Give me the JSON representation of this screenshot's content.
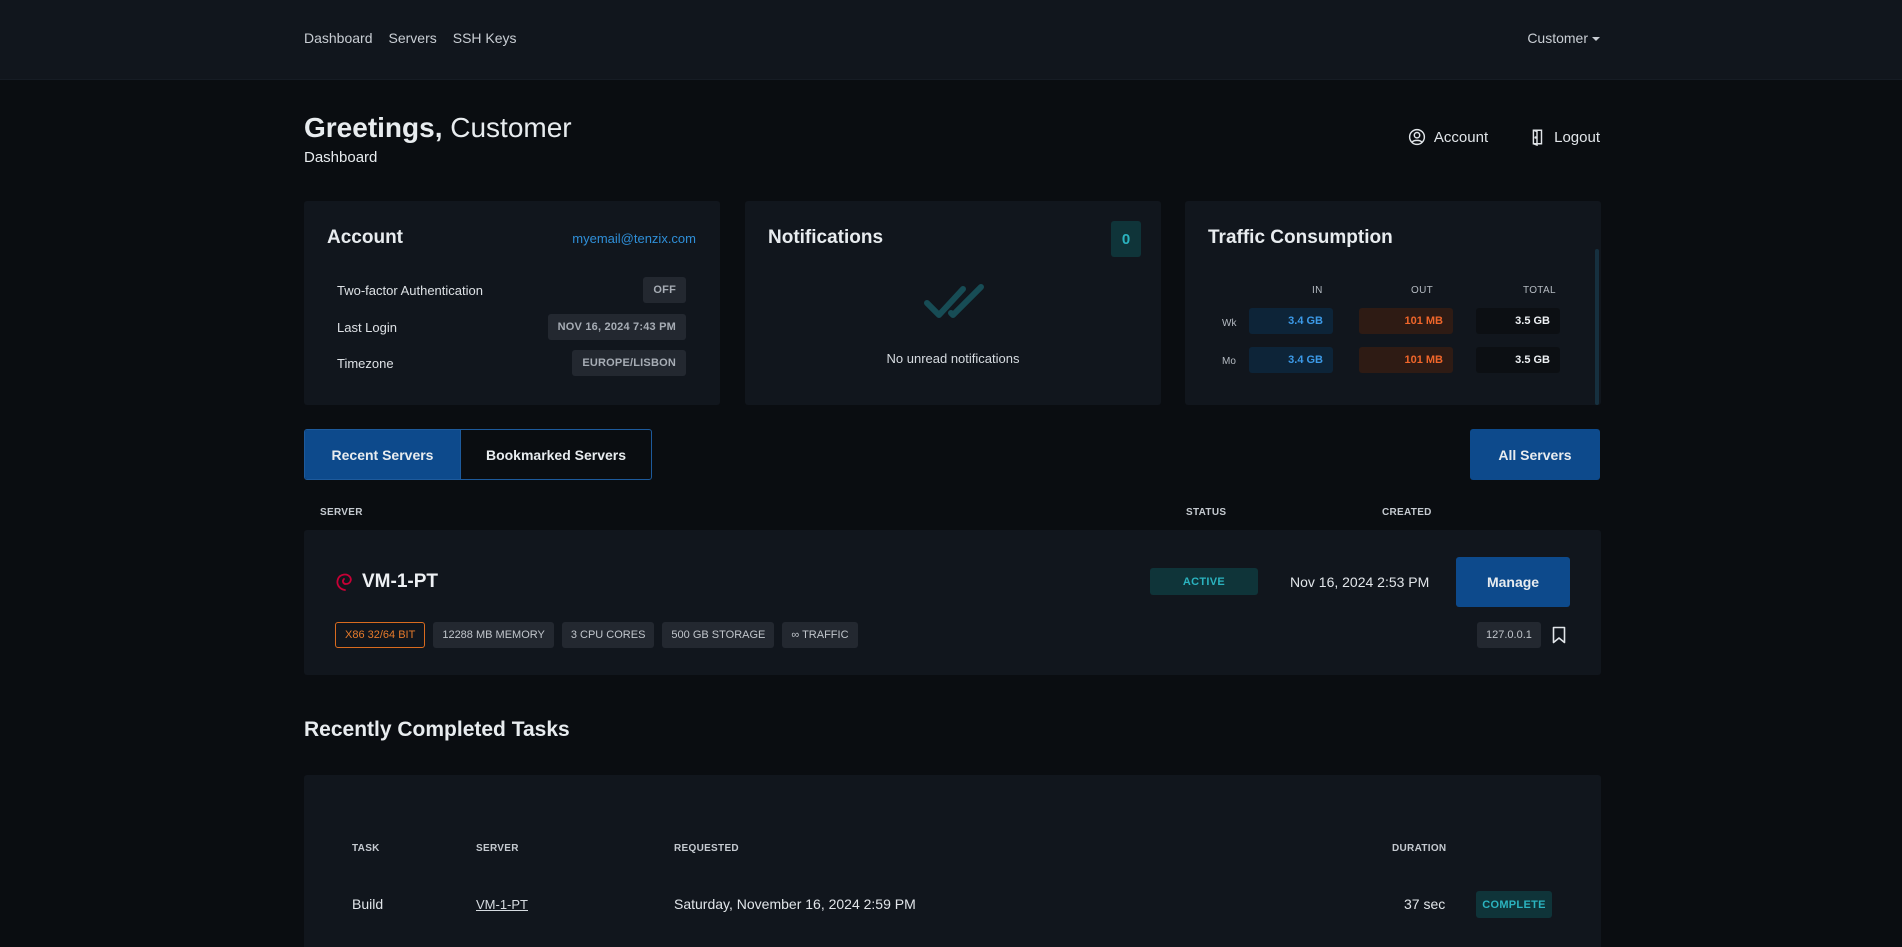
{
  "nav": {
    "items": [
      {
        "label": "Dashboard"
      },
      {
        "label": "Servers"
      },
      {
        "label": "SSH Keys"
      }
    ],
    "user_menu_label": "Customer"
  },
  "header": {
    "greeting": "Greetings,",
    "name": "Customer",
    "subtitle": "Dashboard",
    "account_label": "Account",
    "logout_label": "Logout"
  },
  "account_card": {
    "title": "Account",
    "email": "myemail@tenzix.com",
    "rows": [
      {
        "label": "Two-factor Authentication",
        "value": "OFF"
      },
      {
        "label": "Last Login",
        "value": "NOV 16, 2024 7:43 PM"
      },
      {
        "label": "Timezone",
        "value": "EUROPE/LISBON"
      }
    ]
  },
  "notifications_card": {
    "title": "Notifications",
    "count": "0",
    "empty_text": "No unread notifications"
  },
  "traffic_card": {
    "title": "Traffic Consumption",
    "columns": [
      "IN",
      "OUT",
      "TOTAL"
    ],
    "rows": [
      {
        "label": "Wk",
        "in": "3.4 GB",
        "out": "101 MB",
        "total": "3.5 GB"
      },
      {
        "label": "Mo",
        "in": "3.4 GB",
        "out": "101 MB",
        "total": "3.5 GB"
      }
    ]
  },
  "server_tabs": {
    "recent": "Recent Servers",
    "bookmarked": "Bookmarked Servers",
    "all_servers": "All Servers"
  },
  "server_table": {
    "headers": {
      "server": "SERVER",
      "status": "STATUS",
      "created": "CREATED"
    },
    "servers": [
      {
        "name": "VM-1-PT",
        "status": "ACTIVE",
        "created": "Nov 16, 2024 2:53 PM",
        "manage_label": "Manage",
        "specs": [
          "X86 32/64 BIT",
          "12288 MB MEMORY",
          "3 CPU CORES",
          "500 GB STORAGE",
          "∞ TRAFFIC"
        ],
        "ip": "127.0.0.1"
      }
    ]
  },
  "tasks": {
    "title": "Recently Completed Tasks",
    "headers": {
      "task": "TASK",
      "server": "SERVER",
      "requested": "REQUESTED",
      "duration": "DURATION"
    },
    "rows": [
      {
        "task": "Build",
        "server": "VM-1-PT",
        "requested": "Saturday, November 16, 2024 2:59 PM",
        "duration": "37 sec",
        "status": "COMPLETE"
      }
    ]
  },
  "colors": {
    "background": "#0a0d11",
    "card": "#11161d",
    "primary_blue": "#0d4a8c",
    "teal_badge": "#2bb3bf",
    "traffic_in": "#3c9ae8",
    "traffic_out": "#f0662a",
    "arch_orange": "#e67a2b"
  },
  "icons": [
    "user-circle-icon",
    "logout-door-icon",
    "double-check-icon",
    "debian-swirl-icon",
    "bookmark-icon",
    "caret-down-icon"
  ]
}
